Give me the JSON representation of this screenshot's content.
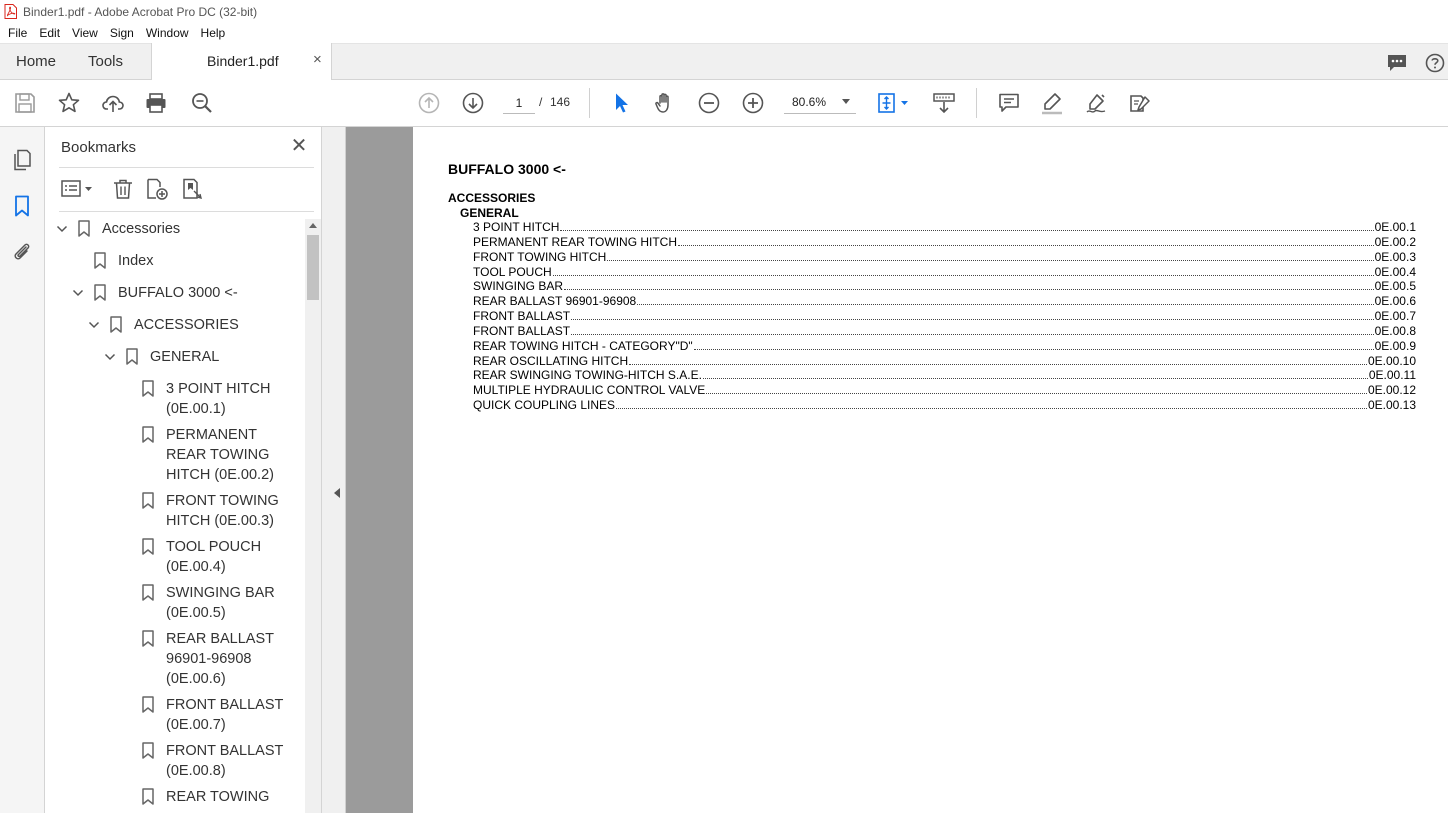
{
  "window": {
    "title": "Binder1.pdf - Adobe Acrobat Pro DC (32-bit)"
  },
  "menu": [
    "File",
    "Edit",
    "View",
    "Sign",
    "Window",
    "Help"
  ],
  "tabs": {
    "home": "Home",
    "tools": "Tools",
    "document": "Binder1.pdf",
    "close": "×"
  },
  "toolbar": {
    "current_page": "1",
    "page_separator": "/",
    "total_pages": "146",
    "zoom": "80.6%"
  },
  "bookmarks_panel": {
    "title": "Bookmarks",
    "close": "✕",
    "items": [
      {
        "label": "Accessories",
        "level": 0,
        "expanded": true
      },
      {
        "label": "Index",
        "level": 1,
        "expanded": null
      },
      {
        "label": "BUFFALO 3000 <-",
        "level": 1,
        "expanded": true
      },
      {
        "label": "ACCESSORIES",
        "level": 2,
        "expanded": true
      },
      {
        "label": "GENERAL",
        "level": 3,
        "expanded": true
      },
      {
        "label": "3 POINT HITCH (0E.00.1)",
        "level": 4,
        "expanded": null
      },
      {
        "label": "PERMANENT REAR TOWING HITCH (0E.00.2)",
        "level": 4,
        "expanded": null
      },
      {
        "label": "FRONT TOWING HITCH (0E.00.3)",
        "level": 4,
        "expanded": null
      },
      {
        "label": "TOOL POUCH (0E.00.4)",
        "level": 4,
        "expanded": null
      },
      {
        "label": "SWINGING BAR (0E.00.5)",
        "level": 4,
        "expanded": null
      },
      {
        "label": "REAR BALLAST 96901-96908 (0E.00.6)",
        "level": 4,
        "expanded": null
      },
      {
        "label": "FRONT BALLAST (0E.00.7)",
        "level": 4,
        "expanded": null
      },
      {
        "label": "FRONT BALLAST (0E.00.8)",
        "level": 4,
        "expanded": null
      },
      {
        "label": "REAR TOWING",
        "level": 4,
        "expanded": null
      }
    ]
  },
  "document": {
    "title": "BUFFALO 3000 <-",
    "section": "ACCESSORIES",
    "subsection": "GENERAL",
    "entries": [
      {
        "title": "3 POINT HITCH",
        "page": "0E.00.1"
      },
      {
        "title": "PERMANENT REAR TOWING HITCH",
        "page": "0E.00.2"
      },
      {
        "title": "FRONT TOWING HITCH",
        "page": "0E.00.3"
      },
      {
        "title": "TOOL POUCH",
        "page": "0E.00.4"
      },
      {
        "title": "SWINGING BAR",
        "page": "0E.00.5"
      },
      {
        "title": "REAR BALLAST 96901-96908",
        "page": "0E.00.6"
      },
      {
        "title": "FRONT BALLAST",
        "page": "0E.00.7"
      },
      {
        "title": "FRONT BALLAST",
        "page": "0E.00.8"
      },
      {
        "title": "REAR TOWING HITCH - CATEGORY\"D\"",
        "page": "0E.00.9"
      },
      {
        "title": "REAR OSCILLATING HITCH",
        "page": "0E.00.10"
      },
      {
        "title": "REAR SWINGING TOWING-HITCH S.A.E.",
        "page": "0E.00.11"
      },
      {
        "title": "MULTIPLE HYDRAULIC CONTROL VALVE",
        "page": "0E.00.12"
      },
      {
        "title": "QUICK COUPLING LINES",
        "page": "0E.00.13"
      }
    ]
  },
  "colors": {
    "accent_blue": "#1473e6",
    "acrobat_red": "#d9261c",
    "viewer_gray": "#9b9b9b",
    "icon_gray": "#555555"
  }
}
